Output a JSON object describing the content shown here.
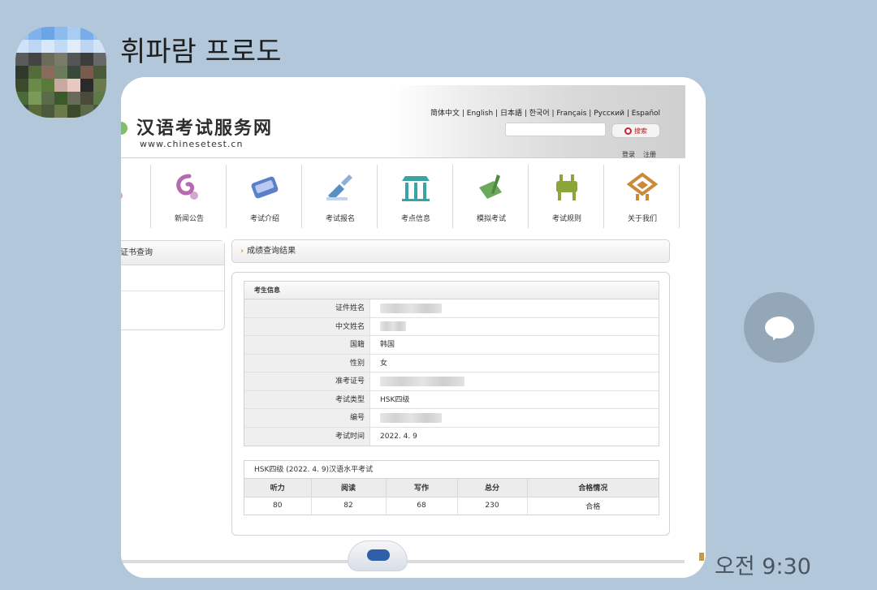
{
  "chat": {
    "sender_name": "휘파람 프로도",
    "time": "오전 9:30",
    "share_icon": "share-bubble-icon"
  },
  "site": {
    "title": "汉语考试服务网",
    "url": "www.chinesetest.cn",
    "languages": "简体中文 | English | 日本語 | 한국어 | Français | Русский | Español",
    "search_label": "搜索",
    "login": "登录",
    "register": "注册"
  },
  "nav": [
    {
      "label": "新闻公告",
      "icon": "swirl-icon",
      "color": "#b86ab0"
    },
    {
      "label": "考试介绍",
      "icon": "scroll-icon",
      "color": "#5b7fc9"
    },
    {
      "label": "考试报名",
      "icon": "brush-icon",
      "color": "#5a8fc6"
    },
    {
      "label": "考点信息",
      "icon": "pavilion-icon",
      "color": "#3aa3a3"
    },
    {
      "label": "模拟考试",
      "icon": "quill-icon",
      "color": "#6aaa5a"
    },
    {
      "label": "考试规则",
      "icon": "vessel-icon",
      "color": "#8aa63a"
    },
    {
      "label": "关于我们",
      "icon": "ornament-icon",
      "color": "#c98a3a"
    }
  ],
  "sidebar": {
    "heading": "证书查询"
  },
  "result": {
    "heading": "成绩查询结果",
    "info_section": "考生信息",
    "fields": [
      {
        "label": "证件姓名",
        "value": ""
      },
      {
        "label": "中文姓名",
        "value": ""
      },
      {
        "label": "国籍",
        "value": "韩国"
      },
      {
        "label": "性别",
        "value": "女"
      },
      {
        "label": "准考证号",
        "value": ""
      },
      {
        "label": "考试类型",
        "value": "HSK四级"
      },
      {
        "label": "编号",
        "value": ""
      },
      {
        "label": "考试时间",
        "value": "2022. 4. 9"
      }
    ],
    "score_section": "HSK四级 (2022. 4. 9)汉语水平考试",
    "score_headers": [
      "听力",
      "阅读",
      "写作",
      "总分",
      "合格情况"
    ],
    "score_values": [
      "80",
      "82",
      "68",
      "230",
      "合格"
    ]
  }
}
